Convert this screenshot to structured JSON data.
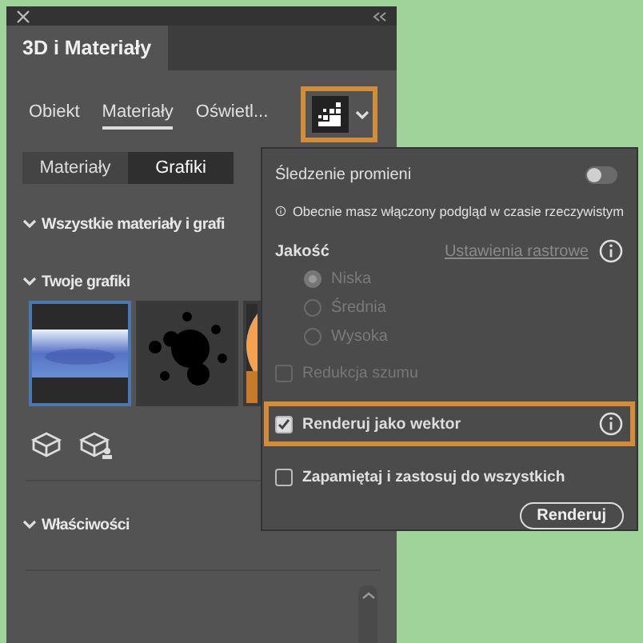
{
  "panel": {
    "title": "3D i Materiały",
    "tabs": [
      {
        "label": "Obiekt",
        "selected": false
      },
      {
        "label": "Materiały",
        "selected": true
      },
      {
        "label": "Oświetl...",
        "selected": false
      }
    ],
    "render_button": {
      "highlighted": true
    },
    "segments": [
      {
        "label": "Materiały",
        "selected": false
      },
      {
        "label": "Grafiki",
        "selected": true
      }
    ],
    "sections": [
      {
        "title": "Wszystkie materiały i grafi",
        "expanded": true
      },
      {
        "title": "Twoje grafiki",
        "expanded": true
      }
    ],
    "graphics": [
      {
        "kind": "gradient",
        "selected": true
      },
      {
        "kind": "splatter",
        "selected": false
      },
      {
        "kind": "circle",
        "selected": false
      }
    ],
    "properties": {
      "title": "Właściwości",
      "expanded": true
    }
  },
  "popup": {
    "ray_tracing": {
      "label": "Śledzenie promieni",
      "on": false
    },
    "info": "Obecnie masz włączony podgląd w czasie rzeczywistym",
    "quality": {
      "label": "Jakość",
      "link": "Ustawienia rastrowe",
      "options": [
        {
          "label": "Niska",
          "selected": true,
          "disabled": true
        },
        {
          "label": "Średnia",
          "selected": false,
          "disabled": true
        },
        {
          "label": "Wysoka",
          "selected": false,
          "disabled": true
        }
      ]
    },
    "checkboxes": [
      {
        "label": "Redukcja szumu",
        "checked": false,
        "disabled": true,
        "highlighted": false,
        "info": false
      },
      {
        "label": "Renderuj jako wektor",
        "checked": true,
        "disabled": false,
        "highlighted": true,
        "info": true
      }
    ],
    "remember": {
      "label": "Zapamiętaj i zastosuj do wszystkich",
      "checked": false
    },
    "button": "Renderuj"
  }
}
